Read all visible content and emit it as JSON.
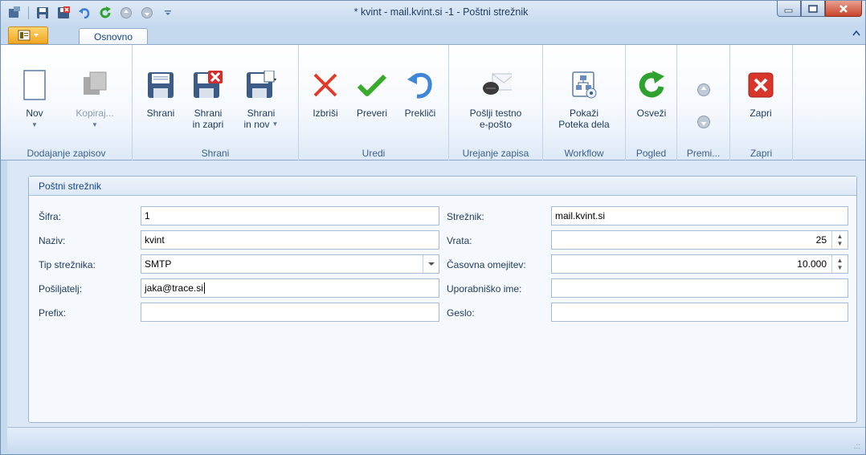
{
  "window": {
    "title": "* kvint - mail.kvint.si -1 - Poštni strežnik"
  },
  "tabs": [
    {
      "label": "Osnovno",
      "active": true
    }
  ],
  "ribbon": {
    "groups": [
      {
        "label": "Dodajanje zapisov",
        "buttons": [
          {
            "label": "Nov",
            "icon": "new-document-icon"
          },
          {
            "label": "Kopiraj...",
            "icon": "copy-icon",
            "disabled": true
          }
        ]
      },
      {
        "label": "Shrani",
        "buttons": [
          {
            "label": "Shrani",
            "icon": "save-icon"
          },
          {
            "label1": "Shrani",
            "label2": "in zapri",
            "icon": "save-close-icon"
          },
          {
            "label1": "Shrani",
            "label2": "in nov",
            "icon": "save-new-icon"
          }
        ]
      },
      {
        "label": "Uredi",
        "buttons": [
          {
            "label": "Izbriši",
            "icon": "delete-x-icon"
          },
          {
            "label": "Preveri",
            "icon": "checkmark-icon"
          },
          {
            "label": "Prekliči",
            "icon": "undo-icon"
          }
        ]
      },
      {
        "label": "Urejanje zapisa",
        "buttons": [
          {
            "label1": "Pošlji testno",
            "label2": "e-pošto",
            "icon": "send-test-email-icon"
          }
        ]
      },
      {
        "label": "Workflow",
        "buttons": [
          {
            "label1": "Pokaži",
            "label2": "Poteka dela",
            "icon": "workflow-icon"
          }
        ]
      },
      {
        "label": "Pogled",
        "buttons": [
          {
            "label": "Osveži",
            "icon": "refresh-icon"
          }
        ]
      },
      {
        "label": "Premi...",
        "buttons": [
          {
            "icon": "arrow-up-icon"
          },
          {
            "icon": "arrow-down-icon"
          }
        ]
      },
      {
        "label": "Zapri",
        "buttons": [
          {
            "label": "Zapri",
            "icon": "close-red-icon"
          }
        ]
      }
    ]
  },
  "panel": {
    "title": "Poštni strežnik"
  },
  "form": {
    "left": [
      {
        "label": "Šifra:",
        "value": "1"
      },
      {
        "label": "Naziv:",
        "value": "kvint"
      },
      {
        "label": "Tip strežnika:",
        "value": "SMTP"
      },
      {
        "label": "Pošiljatelj:",
        "value": "jaka@trace.si"
      },
      {
        "label": "Prefix:",
        "value": ""
      }
    ],
    "right": [
      {
        "label": "Strežnik:",
        "value": "mail.kvint.si"
      },
      {
        "label": "Vrata:",
        "value": "25"
      },
      {
        "label": "Časovna omejitev:",
        "value": "10.000"
      },
      {
        "label": "Uporabniško ime:",
        "value": ""
      },
      {
        "label": "Geslo:",
        "value": ""
      }
    ]
  },
  "colors": {
    "accent": "#15428b",
    "appmenu": "#f0a520",
    "close": "#c8432a",
    "refresh": "#2ea12e"
  }
}
